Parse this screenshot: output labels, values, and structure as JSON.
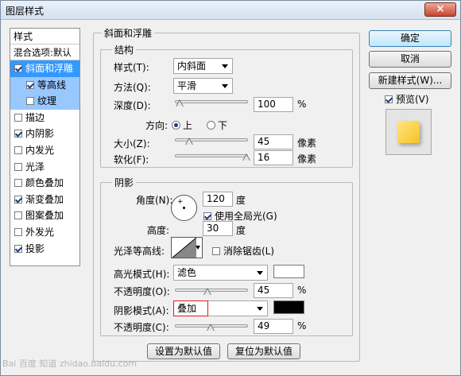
{
  "window": {
    "title": "图层样式",
    "close_glyph": "×"
  },
  "left_panel": {
    "header": "样式",
    "blend": "混合选项:默认",
    "items": [
      {
        "label": "斜面和浮雕",
        "checked": true
      },
      {
        "label": "等高线",
        "checked": true
      },
      {
        "label": "纹理",
        "checked": false
      },
      {
        "label": "描边",
        "checked": false
      },
      {
        "label": "内阴影",
        "checked": true
      },
      {
        "label": "内发光",
        "checked": false
      },
      {
        "label": "光泽",
        "checked": false
      },
      {
        "label": "颜色叠加",
        "checked": false
      },
      {
        "label": "渐变叠加",
        "checked": true
      },
      {
        "label": "图案叠加",
        "checked": false
      },
      {
        "label": "外发光",
        "checked": false
      },
      {
        "label": "投影",
        "checked": true
      }
    ]
  },
  "bevel": {
    "group_title": "斜面和浮雕",
    "structure": {
      "title": "结构",
      "style_label": "样式(T):",
      "style_value": "内斜面",
      "technique_label": "方法(Q):",
      "technique_value": "平滑",
      "depth_label": "深度(D):",
      "depth_value": "100",
      "depth_unit": "%",
      "depth_pos": 0.07,
      "direction_label": "方向:",
      "dir_up": "上",
      "dir_down": "下",
      "size_label": "大小(Z):",
      "size_value": "45",
      "size_unit": "像素",
      "size_pos": 0.2,
      "soften_label": "软化(F):",
      "soften_value": "16",
      "soften_unit": "像素",
      "soften_pos": 0.98
    },
    "shading": {
      "title": "阴影",
      "angle_label": "角度(N):",
      "angle_value": "120",
      "angle_unit": "度",
      "global_light_label": "使用全局光(G)",
      "altitude_label": "高度:",
      "altitude_value": "30",
      "altitude_unit": "度",
      "gloss_label": "光泽等高线:",
      "antialias_label": "消除锯齿(L)",
      "highlight_label": "高光模式(H):",
      "highlight_value": "滤色",
      "highlight_color": "#ffffff",
      "hl_opacity_label": "不透明度(O):",
      "hl_opacity_value": "45",
      "hl_opacity_unit": "%",
      "hl_opacity_pos": 0.45,
      "shadow_label": "阴影模式(A):",
      "shadow_value": "叠加",
      "shadow_color": "#000000",
      "sh_opacity_label": "不透明度(C):",
      "sh_opacity_value": "49",
      "sh_opacity_unit": "%",
      "sh_opacity_pos": 0.49
    },
    "make_default": "设置为默认值",
    "reset_default": "复位为默认值"
  },
  "buttons": {
    "ok": "确定",
    "cancel": "取消",
    "new_style": "新建样式(W)...",
    "preview": "预览(V)"
  },
  "watermark": "Bai 百度 知道 zhidao.baidu.com"
}
